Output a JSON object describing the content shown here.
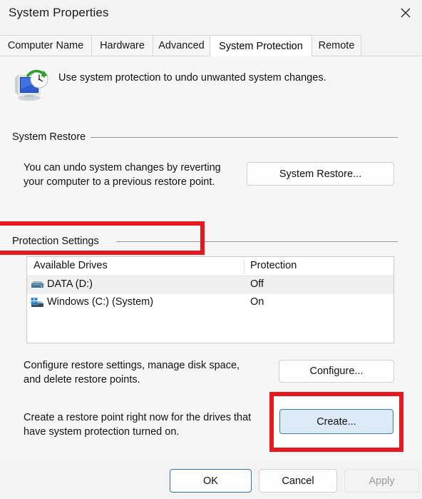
{
  "window": {
    "title": "System Properties",
    "close_icon": "close-icon"
  },
  "tabs": [
    {
      "label": "Computer Name",
      "active": false
    },
    {
      "label": "Hardware",
      "active": false
    },
    {
      "label": "Advanced",
      "active": false
    },
    {
      "label": "System Protection",
      "active": true
    },
    {
      "label": "Remote",
      "active": false
    }
  ],
  "header": {
    "icon": "system-protection-icon",
    "description": "Use system protection to undo unwanted system changes."
  },
  "system_restore": {
    "group_label": "System Restore",
    "description_line1": "You can undo system changes by reverting",
    "description_line2": "your computer to a previous restore point.",
    "button_label": "System Restore..."
  },
  "protection_settings": {
    "group_label": "Protection Settings",
    "columns": [
      "Available Drives",
      "Protection"
    ],
    "rows": [
      {
        "icon": "hard-drive-icon",
        "drive": "DATA (D:)",
        "protection": "Off",
        "selected": true
      },
      {
        "icon": "windows-drive-icon",
        "drive": "Windows (C:) (System)",
        "protection": "On",
        "selected": false
      }
    ],
    "configure_line1": "Configure restore settings, manage disk space,",
    "configure_line2": "and delete restore points.",
    "configure_button": "Configure...",
    "create_line1": "Create a restore point right now for the drives that",
    "create_line2": "have system protection turned on.",
    "create_button": "Create..."
  },
  "footer": {
    "ok_label": "OK",
    "cancel_label": "Cancel",
    "apply_label": "Apply"
  },
  "annotations": {
    "highlight_color": "#e8191e",
    "boxes": [
      "protection-settings-label",
      "create-button"
    ]
  }
}
